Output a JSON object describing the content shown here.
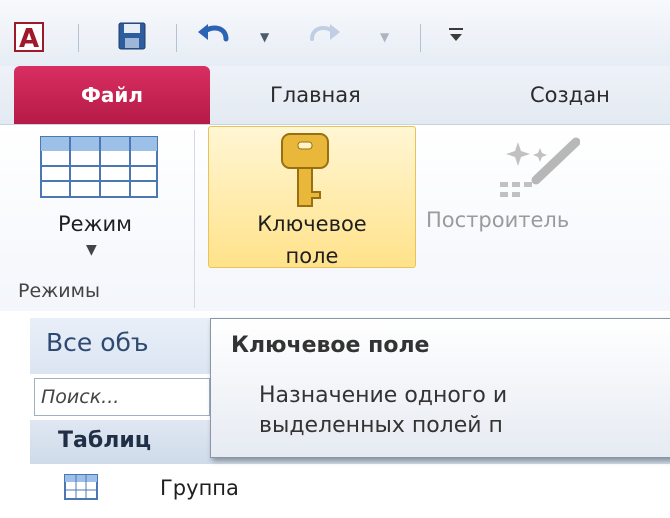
{
  "qat": {
    "app_icon_letter": "A",
    "icons": [
      "access-app-icon",
      "save-icon",
      "undo-icon",
      "redo-icon",
      "customize-qat-icon"
    ]
  },
  "tabs": {
    "file": "Файл",
    "home": "Главная",
    "create": "Создан"
  },
  "ribbon": {
    "mode_button": "Режим",
    "modes_group": "Режимы",
    "key_button_line1": "Ключевое",
    "key_button_line2": "поле",
    "builder_button": "Построитель"
  },
  "nav": {
    "title": "Все объ",
    "search_placeholder": "Поиск...",
    "section": "Таблиц",
    "items": [
      "Группа"
    ]
  },
  "tooltip": {
    "title": "Ключевое поле",
    "text": "Назначение одного и\nвыделенных полей п"
  },
  "colors": {
    "file_tab": "#c8244f",
    "key_highlight": "#ffe28a",
    "nav_title": "#2d4a73"
  }
}
